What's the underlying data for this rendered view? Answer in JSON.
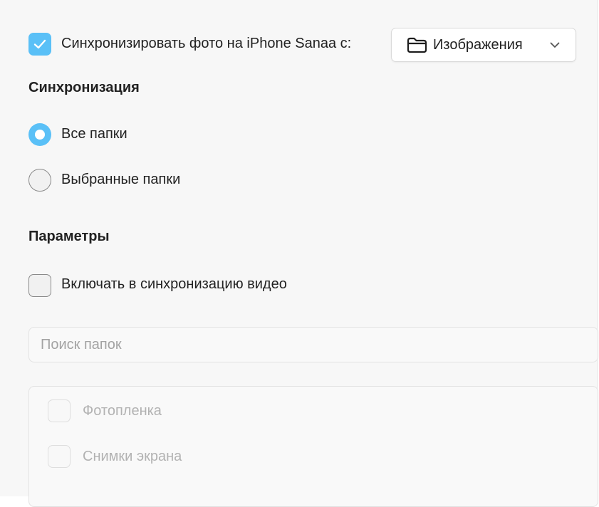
{
  "sync": {
    "checkbox_checked": true,
    "label": "Синхронизировать фото на iPhone Sanaa с:",
    "source_dropdown": {
      "value": "Изображения",
      "icon": "folder-icon"
    }
  },
  "sync_section": {
    "heading": "Синхронизация",
    "options": [
      {
        "label": "Все папки",
        "selected": true
      },
      {
        "label": "Выбранные папки",
        "selected": false
      }
    ]
  },
  "params_section": {
    "heading": "Параметры",
    "include_video": {
      "label": "Включать в синхронизацию видео",
      "checked": false
    }
  },
  "folder_search": {
    "placeholder": "Поиск папок"
  },
  "folders": [
    {
      "label": "Фотопленка",
      "checked": false,
      "enabled": false
    },
    {
      "label": "Снимки экрана",
      "checked": false,
      "enabled": false
    }
  ],
  "colors": {
    "accent": "#5ac0f7",
    "disabled_text": "#b2b2b2"
  }
}
